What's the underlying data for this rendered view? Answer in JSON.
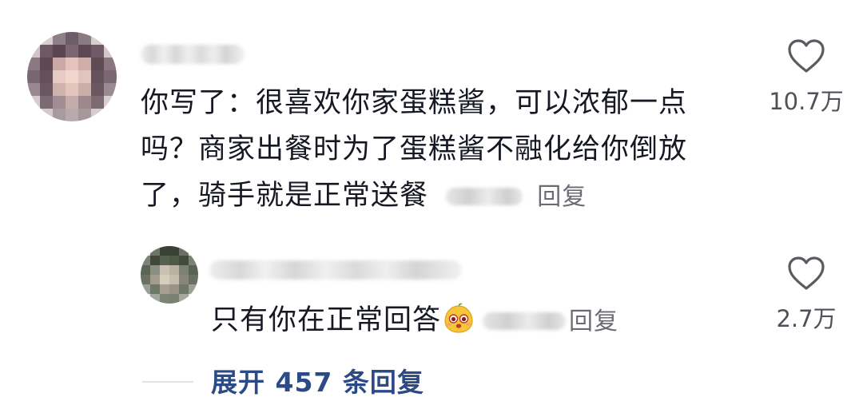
{
  "comment": {
    "text_line1": "你写了：很喜欢你家蛋糕酱，可以浓郁一点",
    "text_line2": "吗？商家出餐时为了蛋糕酱不融化给你倒放",
    "text_line3": "了，骑手就是正常送餐",
    "reply_label": "回复",
    "like_count": "10.7万",
    "like_icon": "heart-icon"
  },
  "reply": {
    "text": "只有你在正常回答",
    "emoji_icon": "mango-face-emoji",
    "reply_label": "回复",
    "like_count": "2.7万",
    "like_icon": "heart-icon"
  },
  "expand": {
    "label": "展开 457 条回复"
  },
  "colors": {
    "text": "#161823",
    "link_blue": "#2c4a86",
    "secondary": "#6b6b73"
  }
}
